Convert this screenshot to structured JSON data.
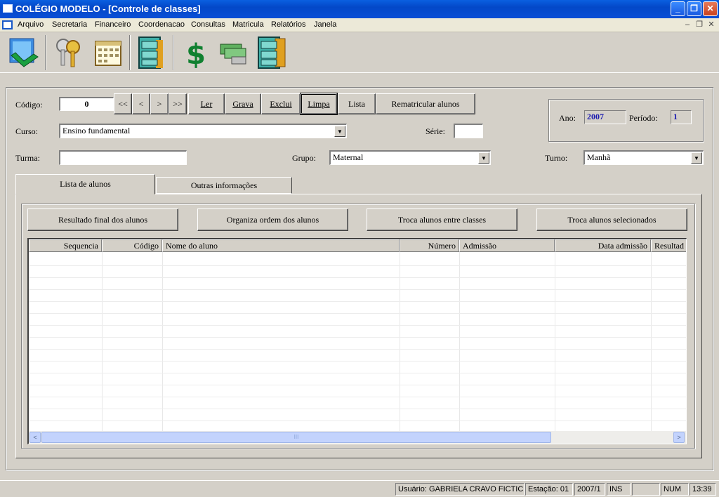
{
  "window": {
    "title": "COLÉGIO MODELO - [Controle de classes]"
  },
  "menu": [
    "Arquivo",
    "Secretaria",
    "Financeiro",
    "Coordenacao",
    "Consultas",
    "Matricula",
    "Relatórios",
    "Janela"
  ],
  "toolbar": [
    "exit-door-icon",
    "keys-icon",
    "calendar-icon",
    "file-cabinet-icon",
    "dollar-icon",
    "money-bills-icon",
    "file-cabinet-open-icon"
  ],
  "form": {
    "codigo_label": "Código:",
    "codigo_value": "0",
    "nav": [
      "<<",
      "<",
      ">",
      ">>"
    ],
    "actions": {
      "ler": "Ler",
      "grava": "Grava",
      "exclui": "Exclui",
      "limpa": "Limpa",
      "lista": "Lista",
      "rematricular": "Rematricular alunos"
    },
    "curso_label": "Curso:",
    "curso_value": "Ensino fundamental",
    "serie_label": "Série:",
    "serie_value": "",
    "turma_label": "Turma:",
    "turma_value": "",
    "grupo_label": "Grupo:",
    "grupo_value": "Maternal",
    "turno_label": "Turno:",
    "turno_value": "Manhã"
  },
  "period": {
    "ano_label": "Ano:",
    "ano_value": "2007",
    "periodo_label": "Período:",
    "periodo_value": "1"
  },
  "tabs": [
    "Lista de alunos",
    "Outras informações"
  ],
  "list_actions": [
    "Resultado final dos alunos",
    "Organiza ordem dos alunos",
    "Troca alunos entre classes",
    "Troca alunos selecionados"
  ],
  "table": {
    "columns": [
      "Sequencia",
      "Código",
      "Nome do aluno",
      "Número",
      "Admissão",
      "Data admissão",
      "Resultad"
    ],
    "rows": []
  },
  "scrollbar": {
    "grip": "III",
    "left": "<",
    "right": ">"
  },
  "status": {
    "usuario": "Usuário: GABRIELA CRAVO FICTICIO",
    "estacao": "Estação: 01",
    "periodo": "2007/1",
    "ins": "INS",
    "blank": "",
    "num": "NUM",
    "time": "13:39"
  }
}
